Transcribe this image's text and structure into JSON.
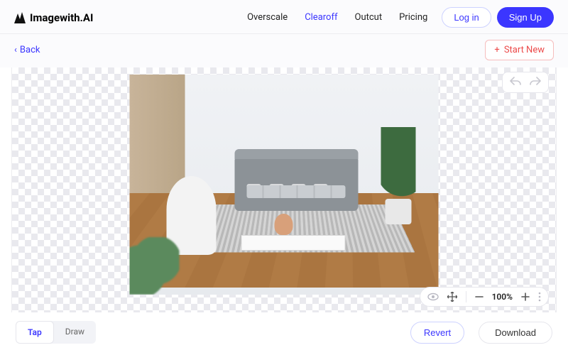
{
  "brand": {
    "name": "Imagewith.AI"
  },
  "nav": {
    "items": [
      "Overscale",
      "Clearoff",
      "Outcut",
      "Pricing"
    ],
    "active_index": 1
  },
  "auth": {
    "login": "Log in",
    "signup": "Sign Up"
  },
  "subbar": {
    "back": "Back",
    "start_new": "Start New"
  },
  "zoom": {
    "value": "100%"
  },
  "modes": {
    "tap": "Tap",
    "draw": "Draw",
    "active": "tap"
  },
  "actions": {
    "revert": "Revert",
    "download": "Download"
  },
  "colors": {
    "primary": "#3b36ff",
    "danger": "#ec4a4a"
  }
}
